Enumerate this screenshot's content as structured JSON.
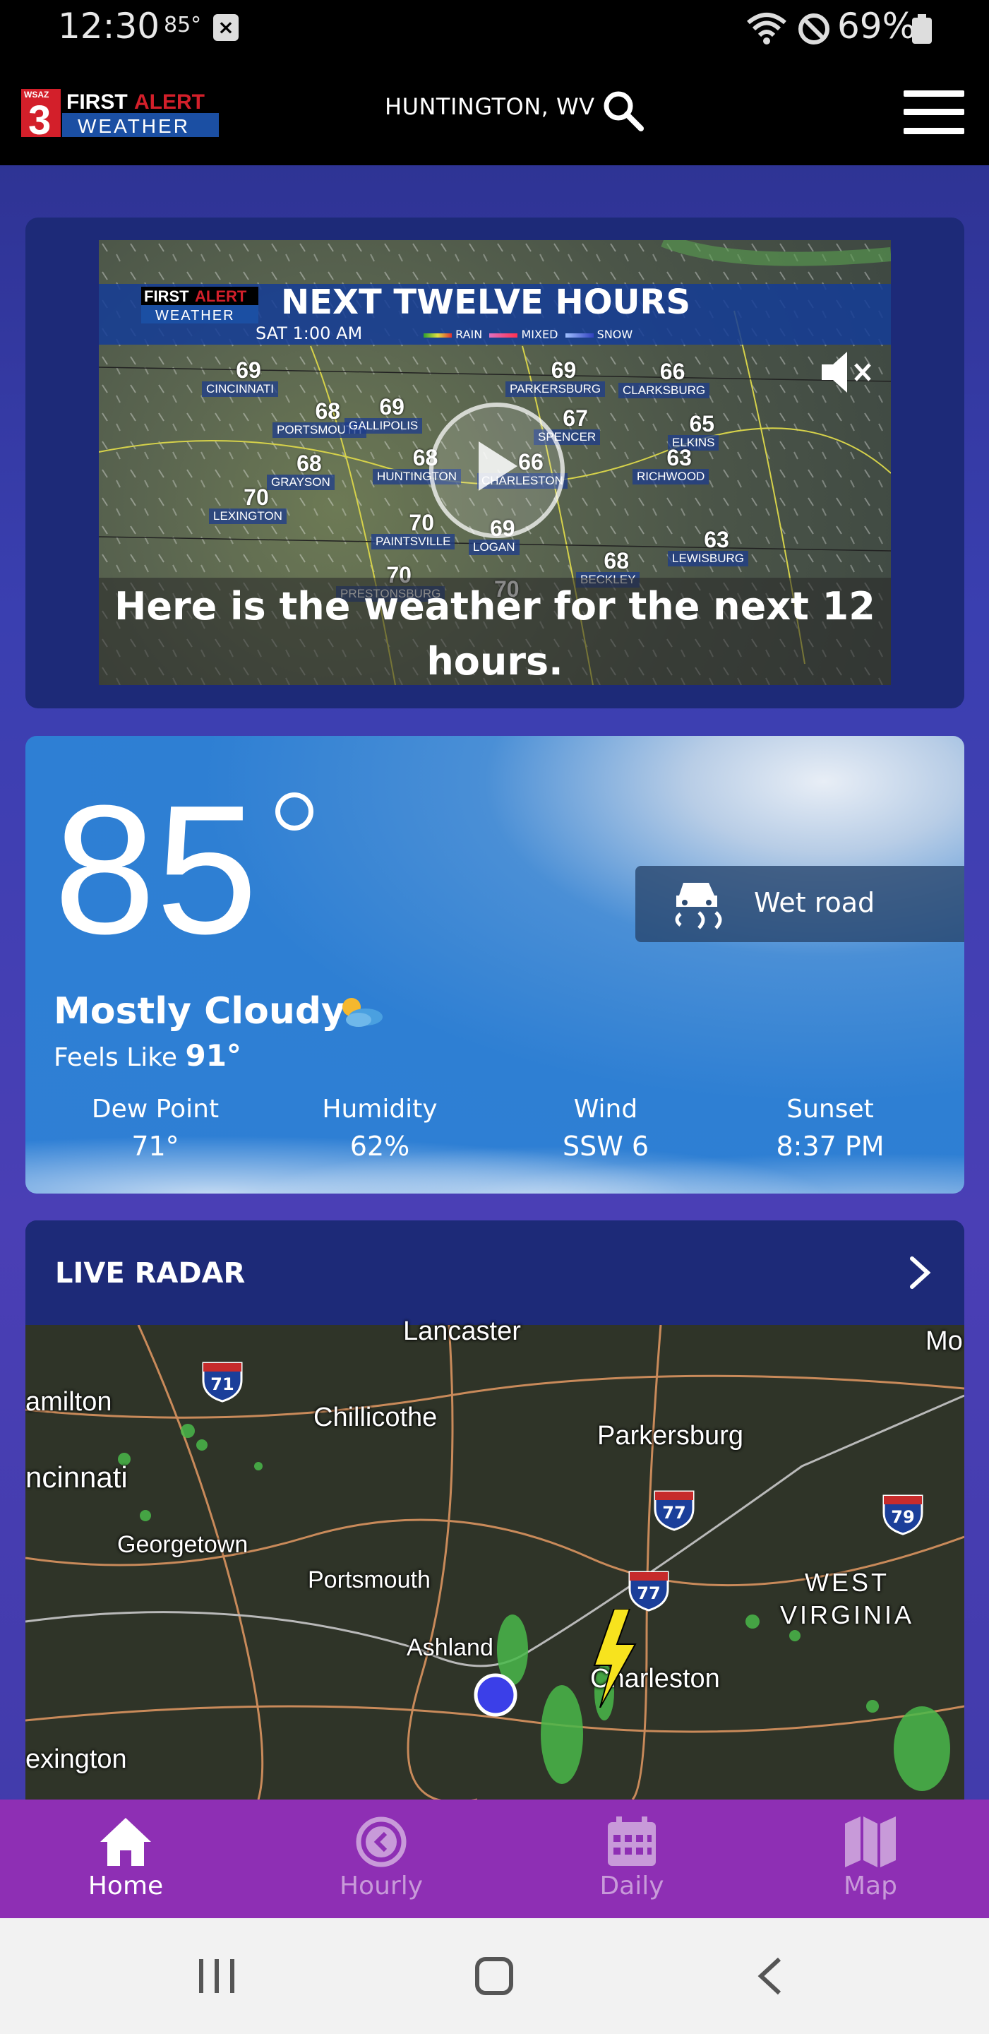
{
  "status_bar": {
    "time": "12:30",
    "temp": "85°",
    "battery": "69%"
  },
  "header": {
    "logo_station": "WSAZ",
    "logo_number": "3",
    "logo_first": "FIRST",
    "logo_alert": "ALERT",
    "logo_weather": "WEATHER",
    "location": "HUNTINGTON, WV"
  },
  "video": {
    "brand_first": "FIRST",
    "brand_alert": "ALERT",
    "brand_weather": "WEATHER",
    "headline": "NEXT TWELVE HOURS",
    "time": "SAT 1:00 AM",
    "legend": [
      "RAIN",
      "MIXED",
      "SNOW"
    ],
    "caption": "Here is the weather for the next 12 hours.",
    "map_points": [
      {
        "temp": "69",
        "city": "CINCINNATI"
      },
      {
        "temp": "68",
        "city": "PORTSMOUTH"
      },
      {
        "temp": "69",
        "city": "GALLIPOLIS"
      },
      {
        "temp": "69",
        "city": "PARKERSBURG"
      },
      {
        "temp": "66",
        "city": "CLARKSBURG"
      },
      {
        "temp": "67",
        "city": "SPENCER"
      },
      {
        "temp": "65",
        "city": "ELKINS"
      },
      {
        "temp": "68",
        "city": "GRAYSON"
      },
      {
        "temp": "68",
        "city": "HUNTINGTON"
      },
      {
        "temp": "66",
        "city": "CHARLESTON"
      },
      {
        "temp": "63",
        "city": "RICHWOOD"
      },
      {
        "temp": "70",
        "city": "LEXINGTON"
      },
      {
        "temp": "70",
        "city": "PAINTSVILLE"
      },
      {
        "temp": "69",
        "city": "LOGAN"
      },
      {
        "temp": "63",
        "city": "LEWISBURG"
      },
      {
        "temp": "68",
        "city": "BECKLEY"
      },
      {
        "temp": "70",
        "city": "PRESTONSBURG"
      },
      {
        "temp": "70",
        "city": ""
      }
    ]
  },
  "current": {
    "temperature": "85",
    "condition": "Mostly Cloudy",
    "feels_like_label": "Feels Like",
    "feels_like_value": "91°",
    "road_condition": "Wet road",
    "stats": [
      {
        "label": "Dew Point",
        "value": "71°"
      },
      {
        "label": "Humidity",
        "value": "62%"
      },
      {
        "label": "Wind",
        "value": "SSW 6"
      },
      {
        "label": "Sunset",
        "value": "8:37 PM"
      }
    ]
  },
  "radar": {
    "title": "LIVE RADAR",
    "places": {
      "lancaster": "Lancaster",
      "hamilton": "amilton",
      "cincinnati": "ncinnati",
      "chillicothe": "Chillicothe",
      "parkersburg": "Parkersburg",
      "georgetown": "Georgetown",
      "portsmouth": "Portsmouth",
      "ashland": "Ashland",
      "charleston": "Charleston",
      "lexington": "exington",
      "west_virginia": "WEST VIRGINIA",
      "mo": "Mo"
    },
    "shields": {
      "i71": "71",
      "i77a": "77",
      "i77b": "77",
      "i79": "79"
    }
  },
  "bottom_nav": [
    {
      "label": "Home",
      "active": true
    },
    {
      "label": "Hourly",
      "active": false
    },
    {
      "label": "Daily",
      "active": false
    },
    {
      "label": "Map",
      "active": false
    }
  ],
  "colors": {
    "nav_bg": "#8e2fb4",
    "card_bg": "#1d2a78",
    "brand_red": "#d31f2a",
    "brand_blue": "#1b4fa3"
  }
}
